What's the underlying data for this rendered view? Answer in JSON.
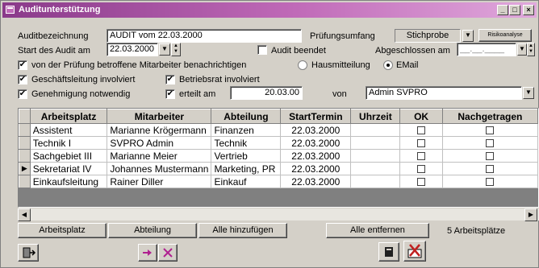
{
  "window": {
    "title": "Auditunterstützung",
    "buttons": [
      "_",
      "□",
      "×"
    ]
  },
  "form": {
    "auditbezeichnung_label": "Auditbezeichnung",
    "auditbezeichnung_value": "AUDIT vom 22.03.2000",
    "pruefungsumfang_label": "Prüfungsumfang",
    "pruefungsumfang_value": "Stichprobe",
    "risikoanalyse_label": "Risikoanalyse",
    "start_label": "Start des Audit am",
    "start_value": "22.03.2000",
    "audit_beendet_label": "Audit beendet",
    "audit_beendet_checked": false,
    "abgeschlossen_label": "Abgeschlossen am",
    "abgeschlossen_value": "__.__.____",
    "benachrichtigen_label": "von der Prüfung betroffene Mitarbeiter benachrichtigen",
    "benachrichtigen_checked": true,
    "hausmitteilung_label": "Hausmitteilung",
    "email_label": "EMail",
    "selected_channel": "EMail",
    "geschaeftsleitung_label": "Geschäftsleitung involviert",
    "geschaeftsleitung_checked": true,
    "betriebsrat_label": "Betriebsrat involviert",
    "betriebsrat_checked": true,
    "genehmigung_label": "Genehmigung notwendig",
    "genehmigung_checked": true,
    "erteilt_label": "erteilt am",
    "erteilt_checked": true,
    "erteilt_value": "20.03.00",
    "von_label": "von",
    "von_value": "Admin SVPRO"
  },
  "table": {
    "columns": [
      "Arbeitsplatz",
      "Mitarbeiter",
      "Abteilung",
      "StartTermin",
      "Uhrzeit",
      "OK",
      "Nachgetragen"
    ],
    "rows": [
      {
        "arbeitsplatz": "Assistent",
        "mitarbeiter": "Marianne Krögermann",
        "abteilung": "Finanzen",
        "starttermin": "22.03.2000",
        "uhrzeit": "",
        "ok": false,
        "nachgetragen": false,
        "current": false
      },
      {
        "arbeitsplatz": "Technik I",
        "mitarbeiter": "SVPRO Admin",
        "abteilung": "Technik",
        "starttermin": "22.03.2000",
        "uhrzeit": "",
        "ok": false,
        "nachgetragen": false,
        "current": false
      },
      {
        "arbeitsplatz": "Sachgebiet III",
        "mitarbeiter": "Marianne Meier",
        "abteilung": "Vertrieb",
        "starttermin": "22.03.2000",
        "uhrzeit": "",
        "ok": false,
        "nachgetragen": false,
        "current": false
      },
      {
        "arbeitsplatz": "Sekretariat IV",
        "mitarbeiter": "Johannes Mustermann",
        "abteilung": "Marketing, PR",
        "starttermin": "22.03.2000",
        "uhrzeit": "",
        "ok": false,
        "nachgetragen": false,
        "current": true
      },
      {
        "arbeitsplatz": "Einkaufsleitung",
        "mitarbeiter": "Rainer Diller",
        "abteilung": "Einkauf",
        "starttermin": "22.03.2000",
        "uhrzeit": "",
        "ok": false,
        "nachgetragen": false,
        "current": false
      }
    ]
  },
  "actions": {
    "arbeitsplatz_label": "Arbeitsplatz",
    "abteilung_label": "Abteilung",
    "alle_hinzufuegen_label": "Alle hinzufügen",
    "alle_entfernen_label": "Alle entfernen",
    "count_text": "5 Arbeitsplätze"
  },
  "colors": {
    "titlebar_start": "#8a3a8a",
    "titlebar_end": "#e0a8dc",
    "face": "#d4d0c8"
  }
}
